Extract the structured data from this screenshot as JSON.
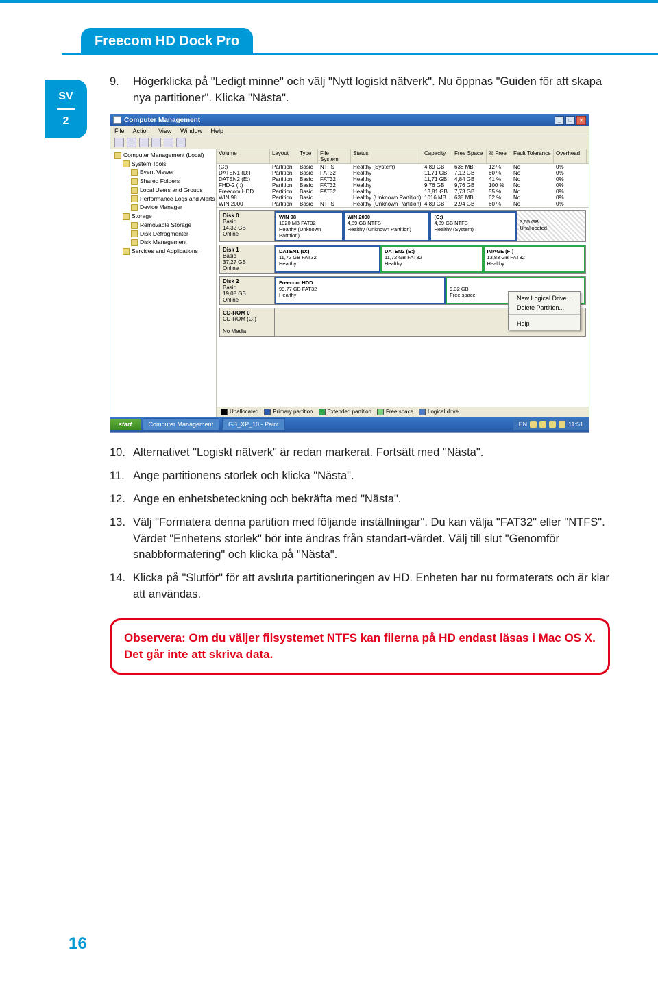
{
  "header": {
    "title": "Freecom HD Dock Pro"
  },
  "sidebar": {
    "lang": "SV",
    "chapter": "2"
  },
  "page_number": "16",
  "steps": [
    {
      "n": "9.",
      "text": "Högerklicka på \"Ledigt minne\" och välj \"Nytt logiskt nätverk\". Nu öppnas \"Guiden för att skapa nya partitioner\". Klicka \"Nästa\"."
    },
    {
      "n": "10.",
      "text": "Alternativet \"Logiskt nätverk\" är redan markerat. Fortsätt med \"Nästa\"."
    },
    {
      "n": "11.",
      "text": "Ange partitionens storlek och klicka \"Nästa\"."
    },
    {
      "n": "12.",
      "text": "Ange en enhetsbeteckning och bekräfta med \"Nästa\"."
    },
    {
      "n": "13.",
      "text": "Välj \"Formatera denna partition med följande inställningar\". Du kan välja \"FAT32\" eller \"NTFS\". Värdet \"Enhetens storlek\" bör inte ändras från standart-värdet. Välj till slut \"Genomför snabbformatering\" och klicka på \"Nästa\"."
    },
    {
      "n": "14.",
      "text": "Klicka på \"Slutför\" för att avsluta partitioneringen av HD. Enheten har nu formaterats och är klar att användas."
    }
  ],
  "note": "Observera: Om du väljer filsystemet NTFS kan filerna på HD endast läsas i Mac OS X. Det går inte att skriva data.",
  "screenshot": {
    "title": "Computer Management",
    "menus": [
      "File",
      "Action",
      "View",
      "Window",
      "Help"
    ],
    "tree": [
      {
        "label": "Computer Management (Local)",
        "indent": 0
      },
      {
        "label": "System Tools",
        "indent": 1
      },
      {
        "label": "Event Viewer",
        "indent": 2
      },
      {
        "label": "Shared Folders",
        "indent": 2
      },
      {
        "label": "Local Users and Groups",
        "indent": 2
      },
      {
        "label": "Performance Logs and Alerts",
        "indent": 2
      },
      {
        "label": "Device Manager",
        "indent": 2
      },
      {
        "label": "Storage",
        "indent": 1
      },
      {
        "label": "Removable Storage",
        "indent": 2
      },
      {
        "label": "Disk Defragmenter",
        "indent": 2
      },
      {
        "label": "Disk Management",
        "indent": 2
      },
      {
        "label": "Services and Applications",
        "indent": 1
      }
    ],
    "columns": [
      "Volume",
      "Layout",
      "Type",
      "File System",
      "Status",
      "Capacity",
      "Free Space",
      "% Free",
      "Fault Tolerance",
      "Overhead"
    ],
    "volumes": [
      {
        "vol": "(C:)",
        "lay": "Partition",
        "typ": "Basic",
        "fs": "NTFS",
        "stat": "Healthy (System)",
        "cap": "4,89 GB",
        "free": "638 MB",
        "pct": "12 %",
        "ft": "No",
        "ov": "0%"
      },
      {
        "vol": "DATEN1 (D:)",
        "lay": "Partition",
        "typ": "Basic",
        "fs": "FAT32",
        "stat": "Healthy",
        "cap": "11,71 GB",
        "free": "7,12 GB",
        "pct": "60 %",
        "ft": "No",
        "ov": "0%"
      },
      {
        "vol": "DATEN2 (E:)",
        "lay": "Partition",
        "typ": "Basic",
        "fs": "FAT32",
        "stat": "Healthy",
        "cap": "11,71 GB",
        "free": "4,84 GB",
        "pct": "41 %",
        "ft": "No",
        "ov": "0%"
      },
      {
        "vol": "FHD-2 (I:)",
        "lay": "Partition",
        "typ": "Basic",
        "fs": "FAT32",
        "stat": "Healthy",
        "cap": "9,76 GB",
        "free": "9,76 GB",
        "pct": "100 %",
        "ft": "No",
        "ov": "0%"
      },
      {
        "vol": "Freecom HDD",
        "lay": "Partition",
        "typ": "Basic",
        "fs": "FAT32",
        "stat": "Healthy",
        "cap": "13,81 GB",
        "free": "7,73 GB",
        "pct": "55 %",
        "ft": "No",
        "ov": "0%"
      },
      {
        "vol": "WIN 98",
        "lay": "Partition",
        "typ": "Basic",
        "fs": "",
        "stat": "Healthy (Unknown Partition)",
        "cap": "1016 MB",
        "free": "638 MB",
        "pct": "62 %",
        "ft": "No",
        "ov": "0%"
      },
      {
        "vol": "WIN 2000",
        "lay": "Partition",
        "typ": "Basic",
        "fs": "NTFS",
        "stat": "Healthy (Unknown Partition)",
        "cap": "4,89 GB",
        "free": "2,94 GB",
        "pct": "60 %",
        "ft": "No",
        "ov": "0%"
      }
    ],
    "disks": [
      {
        "name": "Disk 0",
        "meta": "Basic\n14,32 GB\nOnline",
        "parts": [
          {
            "title": "WIN 98",
            "sub": "1020 MB FAT32\nHealthy (Unknown Partition)",
            "cls": "blue",
            "w": "22%"
          },
          {
            "title": "WIN 2000",
            "sub": "4,89 GB NTFS\nHealthy (Unknown Partition)",
            "cls": "blue",
            "w": "28%"
          },
          {
            "title": "(C:)",
            "sub": "4,89 GB NTFS\nHealthy (System)",
            "cls": "blue",
            "w": "28%"
          },
          {
            "title": "",
            "sub": "3,55 GB\nUnallocated",
            "cls": "blackstripe",
            "w": "22%"
          }
        ]
      },
      {
        "name": "Disk 1",
        "meta": "Basic\n37,27 GB\nOnline",
        "parts": [
          {
            "title": "DATEN1 (D:)",
            "sub": "11,72 GB FAT32\nHealthy",
            "cls": "blue",
            "w": "34%"
          },
          {
            "title": "DATEN2 (E:)",
            "sub": "11,72 GB FAT32\nHealthy",
            "cls": "green",
            "w": "33%"
          },
          {
            "title": "IMAGE (F:)",
            "sub": "13,83 GB FAT32\nHealthy",
            "cls": "green",
            "w": "33%"
          }
        ]
      },
      {
        "name": "Disk 2",
        "meta": "Basic\n19,08 GB\nOnline",
        "parts": [
          {
            "title": "Freecom HDD",
            "sub": "99,77 GB FAT32\nHealthy",
            "cls": "blue",
            "w": "55%"
          },
          {
            "title": "",
            "sub": "9,32 GB\nFree space",
            "cls": "green",
            "w": "45%"
          }
        ]
      },
      {
        "name": "CD-ROM 0",
        "meta": "CD-ROM (G:)\n\nNo Media",
        "parts": []
      }
    ],
    "context_menu": [
      "New Logical Drive...",
      "Delete Partition...",
      "Help"
    ],
    "legend": [
      "Unallocated",
      "Primary partition",
      "Extended partition",
      "Free space",
      "Logical drive"
    ],
    "taskbar": {
      "start": "start",
      "items": [
        "Computer Management",
        "GB_XP_10 - Paint"
      ],
      "tray_text": "EN",
      "clock": "11:51"
    }
  }
}
